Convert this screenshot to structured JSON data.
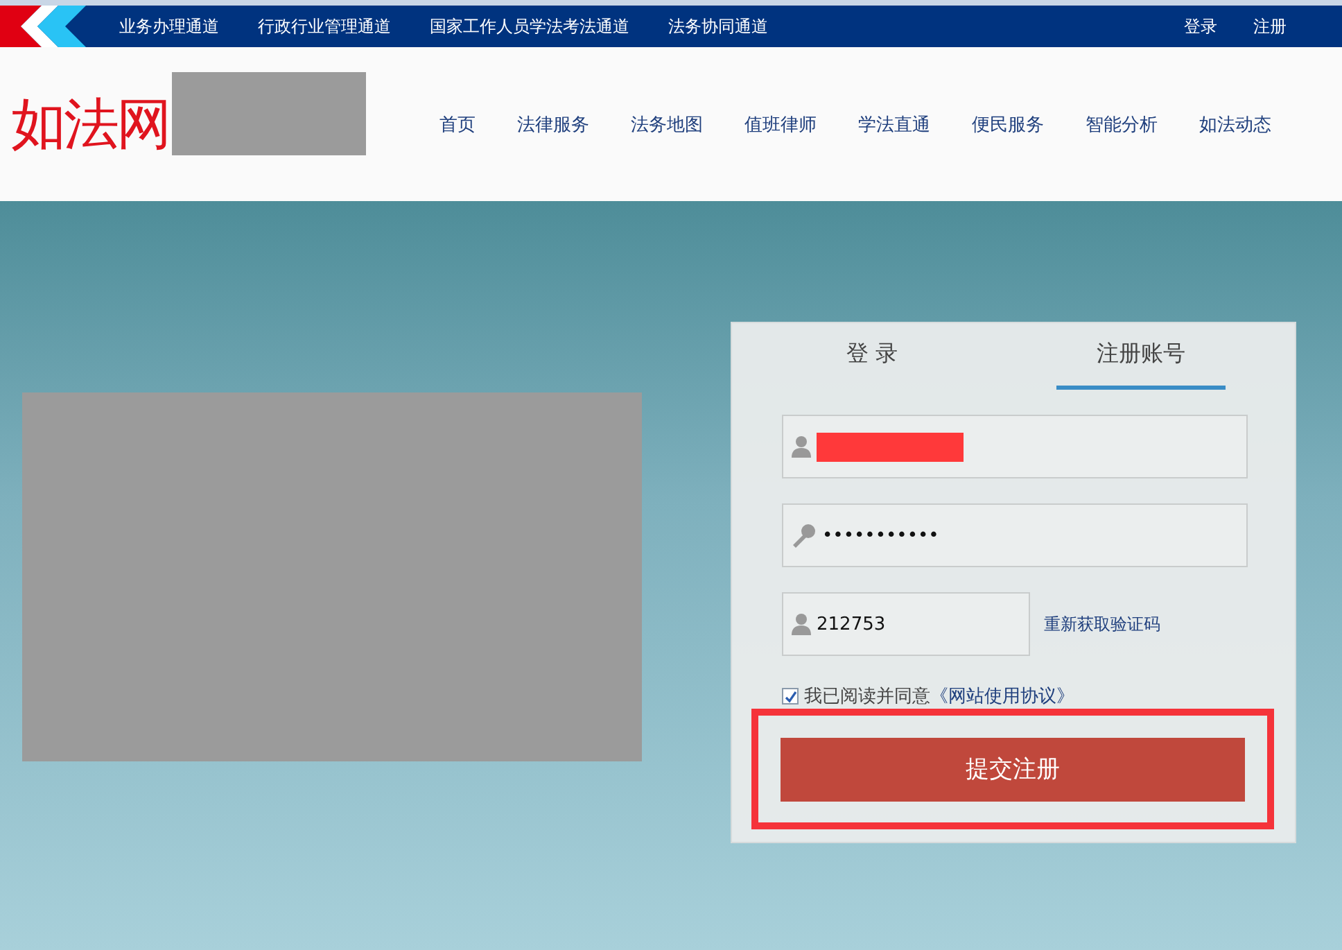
{
  "top_bar": {
    "links": [
      "业务办理通道",
      "行政行业管理通道",
      "国家工作人员学法考法通道",
      "法务协同通道"
    ],
    "account_links": [
      "登录",
      "注册"
    ]
  },
  "header": {
    "logo": "如法网",
    "nav": [
      "首页",
      "法律服务",
      "法务地图",
      "值班律师",
      "学法直通",
      "便民服务",
      "智能分析",
      "如法动态"
    ]
  },
  "panel": {
    "tabs": [
      {
        "label": "登 录",
        "selected": false
      },
      {
        "label": "注册账号",
        "selected": true
      }
    ],
    "fields": [
      {
        "kind": "user",
        "redacted": true
      },
      {
        "kind": "key",
        "value": "•••••••••••",
        "redacted": false
      }
    ],
    "code_field": {
      "value": "212753"
    },
    "resend_link": "重新获取验证码",
    "agreement": {
      "checked": true,
      "text": "我已阅读并同意",
      "link": "《网站使用协议》"
    },
    "submit": "提交注册",
    "submit_highlighted": true
  }
}
